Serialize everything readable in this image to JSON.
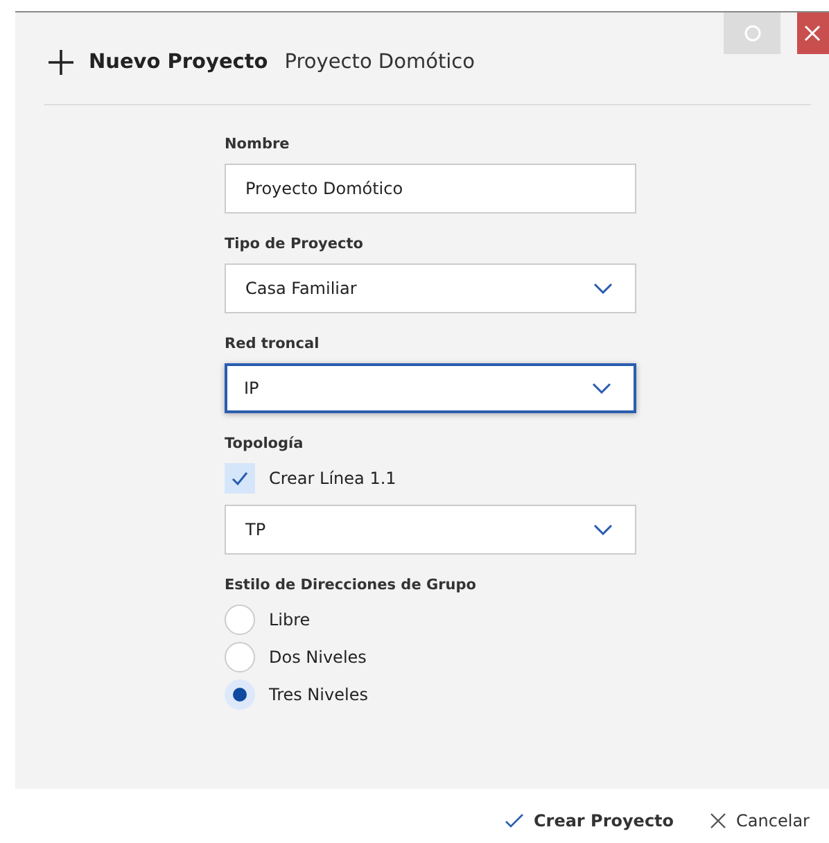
{
  "window": {
    "title": "Nuevo Proyecto",
    "subtitle": "Proyecto Domótico"
  },
  "fields": [
    {
      "kind": "text",
      "label": "Nombre",
      "value": "Proyecto Domótico",
      "focused": false
    },
    {
      "kind": "select",
      "label": "Tipo de Proyecto",
      "value": "Casa Familiar",
      "focused": false
    },
    {
      "kind": "select",
      "label": "Red troncal",
      "value": "IP",
      "focused": true
    },
    {
      "kind": "checkselect",
      "label": "Topología",
      "check_label": "Crear Línea 1.1",
      "checked": true,
      "value": "TP",
      "focused": false
    }
  ],
  "address_style": {
    "label": "Estilo de Direcciones de Grupo",
    "options": [
      {
        "label": "Libre",
        "selected": false
      },
      {
        "label": "Dos Niveles",
        "selected": false
      },
      {
        "label": "Tres Niveles",
        "selected": true
      }
    ]
  },
  "buttons": [
    {
      "kind": "confirm",
      "label": "Crear Proyecto"
    },
    {
      "kind": "cancel",
      "label": "Cancelar"
    }
  ]
}
